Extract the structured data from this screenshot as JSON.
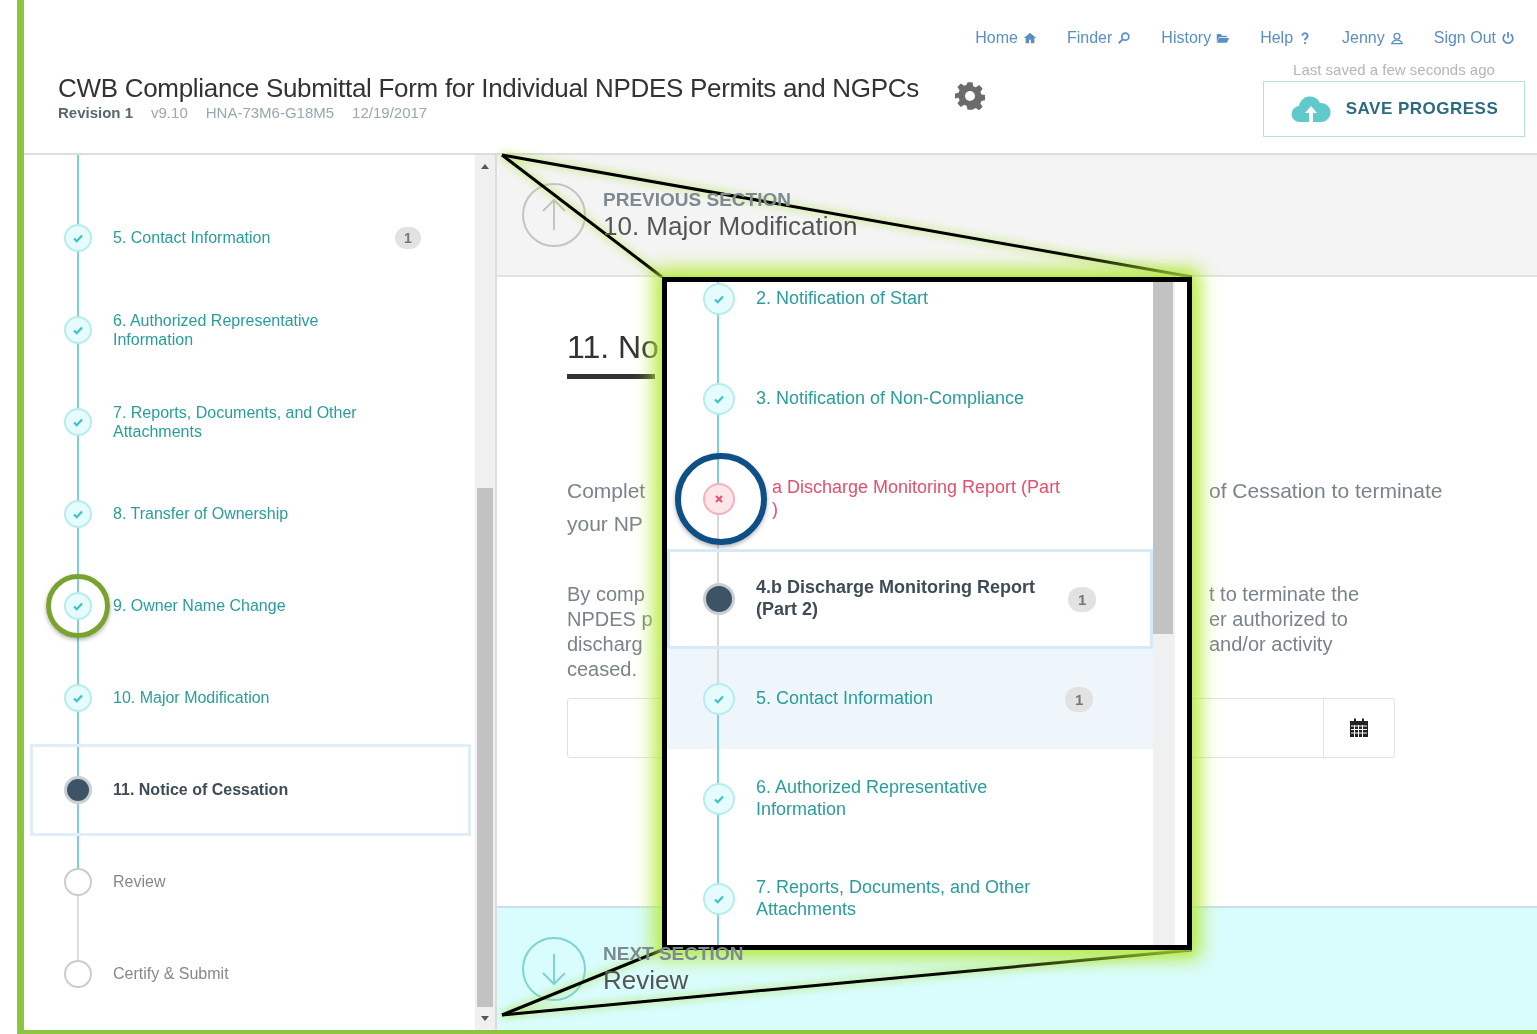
{
  "header": {
    "nav": [
      {
        "label": "Home",
        "kind": "home"
      },
      {
        "label": "Finder",
        "kind": "search"
      },
      {
        "label": "History",
        "kind": "folder"
      },
      {
        "label": "Help",
        "kind": "help"
      },
      {
        "label": "Jenny",
        "kind": "user"
      },
      {
        "label": "Sign Out",
        "kind": "signout"
      }
    ],
    "title": "CWB Compliance Submittal Form for Individual NPDES Permits and NGPCs",
    "meta": {
      "revision": "Revision 1",
      "version": "v9.10",
      "code": "HNA-73M6-G18M5",
      "date": "12/19/2017"
    },
    "last_saved": "Last saved a few seconds ago",
    "save_button": "SAVE PROGRESS"
  },
  "sidebar": {
    "steps": [
      {
        "label": "5. Contact Information",
        "kind": "complete",
        "badge": "1",
        "selected": false,
        "circled": false
      },
      {
        "label": "6. Authorized Representative Information",
        "kind": "complete",
        "selected": false,
        "circled": false
      },
      {
        "label": "7. Reports, Documents, and Other Attachments",
        "kind": "complete",
        "selected": false,
        "circled": false
      },
      {
        "label": "8. Transfer of Ownership",
        "kind": "complete",
        "selected": false,
        "circled": false
      },
      {
        "label": "9. Owner Name Change",
        "kind": "complete",
        "selected": false,
        "circled": true
      },
      {
        "label": "10. Major Modification",
        "kind": "complete",
        "selected": false,
        "circled": false
      },
      {
        "label": "11. Notice of Cessation",
        "kind": "current",
        "selected": true,
        "circled": false
      },
      {
        "label": "Review",
        "kind": "pending",
        "selected": false,
        "circled": false
      },
      {
        "label": "Certify & Submit",
        "kind": "pending",
        "selected": false,
        "circled": false
      }
    ]
  },
  "previous_section": {
    "label": "PREVIOUS SECTION",
    "title": "10. Major Modification"
  },
  "content": {
    "heading": "11. No",
    "intro": {
      "left": [
        "Complet",
        "your NP"
      ],
      "right": [
        "of Cessation to terminate"
      ]
    },
    "body": {
      "left": [
        "By comp",
        "NPDES p",
        "discharg",
        "ceased."
      ],
      "right": [
        "t to terminate the",
        "er authorized to",
        "and/or activity"
      ]
    }
  },
  "next_section": {
    "label": "NEXT SECTION",
    "title": "Review"
  },
  "callout": {
    "steps": [
      {
        "label": "2. Notification of Start",
        "kind": "complete",
        "selected": false,
        "hovered": false,
        "circled": false
      },
      {
        "label": "3. Notification of Non-Compliance",
        "kind": "complete",
        "selected": false,
        "hovered": false,
        "circled": false
      },
      {
        "label": "a Discharge Monitoring Report (Part\n)",
        "kind": "error",
        "selected": false,
        "hovered": false,
        "circled": true
      },
      {
        "label": "4.b Discharge Monitoring Report (Part 2)",
        "kind": "current",
        "badge": "1",
        "selected": true,
        "hovered": false,
        "circled": false
      },
      {
        "label": "5. Contact Information",
        "kind": "complete",
        "badge": "1",
        "selected": false,
        "hovered": true,
        "circled": false
      },
      {
        "label": "6. Authorized Representative Information",
        "kind": "complete",
        "selected": false,
        "hovered": false,
        "circled": false
      },
      {
        "label": "7. Reports, Documents, and Other Attachments",
        "kind": "complete",
        "selected": false,
        "hovered": false,
        "circled": false
      }
    ]
  }
}
